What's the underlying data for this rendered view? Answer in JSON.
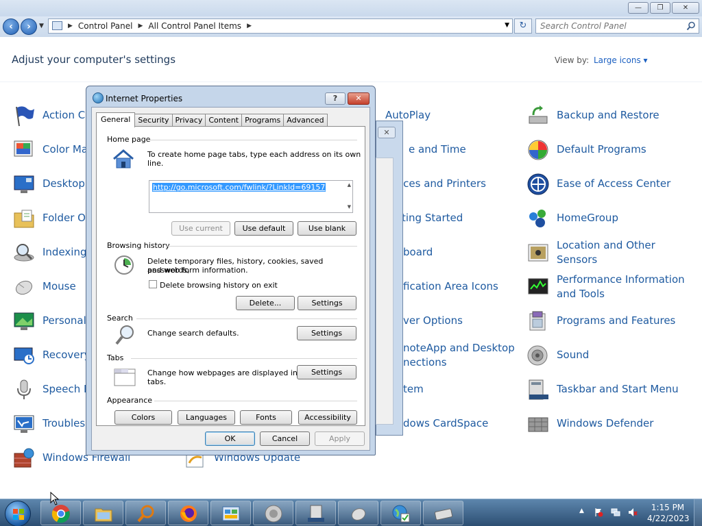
{
  "window": {
    "caption": {
      "minimize": "—",
      "maximize": "❐",
      "close": "✕"
    }
  },
  "nav": {
    "breadcrumb": [
      "Control Panel",
      "All Control Panel Items"
    ],
    "search_placeholder": "Search Control Panel"
  },
  "header": {
    "title": "Adjust your computer's settings",
    "view_by_label": "View by:",
    "view_by_value": "Large icons ▾"
  },
  "control_panel_items": [
    {
      "label": "Action Ce",
      "icon": "flag-icon"
    },
    {
      "label": "Color Ma",
      "icon": "color-management-icon"
    },
    {
      "label": "Desktop (",
      "icon": "desktop-gadgets-icon"
    },
    {
      "label": "Folder Op",
      "icon": "folder-options-icon"
    },
    {
      "label": "Indexing",
      "icon": "indexing-options-icon"
    },
    {
      "label": "Mouse",
      "icon": "mouse-icon"
    },
    {
      "label": "Personali",
      "icon": "personalization-icon"
    },
    {
      "label": "Recovery",
      "icon": "recovery-icon"
    },
    {
      "label": "Speech R",
      "icon": "microphone-icon"
    },
    {
      "label": "Troublesh",
      "icon": "troubleshooting-icon"
    },
    {
      "label": "Windows Firewall",
      "icon": "firewall-icon"
    },
    {
      "label": "Windows Update",
      "icon": "windows-update-icon"
    },
    {
      "label": "AutoPlay",
      "icon": "autoplay-icon"
    },
    {
      "label": "e and Time",
      "icon": "date-time-icon"
    },
    {
      "label": "ices and Printers",
      "icon": "printer-icon"
    },
    {
      "label": "ting Started",
      "icon": "getting-started-icon"
    },
    {
      "label": "board",
      "icon": "keyboard-icon"
    },
    {
      "label": "fication Area Icons",
      "icon": "notification-icon"
    },
    {
      "label": "ver Options",
      "icon": "power-icon"
    },
    {
      "label": "noteApp and Desktop",
      "label2": "nections",
      "icon": "remoteapp-icon"
    },
    {
      "label": "tem",
      "icon": "system-icon"
    },
    {
      "label": "dows CardSpace",
      "icon": "cardspace-icon"
    },
    {
      "label": "Backup and Restore",
      "icon": "backup-icon"
    },
    {
      "label": "Default Programs",
      "icon": "default-programs-icon"
    },
    {
      "label": "Ease of Access Center",
      "icon": "ease-of-access-icon"
    },
    {
      "label": "HomeGroup",
      "icon": "homegroup-icon"
    },
    {
      "label": "Location and Other Sensors",
      "icon": "location-sensors-icon"
    },
    {
      "label": "Performance Information and Tools",
      "icon": "performance-icon"
    },
    {
      "label": "Programs and Features",
      "icon": "programs-features-icon"
    },
    {
      "label": "Sound",
      "icon": "sound-icon"
    },
    {
      "label": "Taskbar and Start Menu",
      "icon": "taskbar-icon"
    },
    {
      "label": "Windows Defender",
      "icon": "defender-icon"
    }
  ],
  "dialog": {
    "title": "Internet Properties",
    "help_button": "?",
    "close_button": "✕",
    "back_close": "✕",
    "tabs": [
      "General",
      "Security",
      "Privacy",
      "Content",
      "Programs",
      "Advanced"
    ],
    "active_tab": "General",
    "home_page": {
      "heading": "Home page",
      "instructions": "To create home page tabs, type each address on its own line.",
      "url": "http://go.microsoft.com/fwlink/?LinkId=69157",
      "use_current": "Use current",
      "use_default": "Use default",
      "use_blank": "Use blank"
    },
    "browsing_history": {
      "heading": "Browsing history",
      "description_line1": "Delete temporary files, history, cookies, saved passwords,",
      "description_line2": "and web form information.",
      "delete_on_exit": "Delete browsing history on exit",
      "delete_button": "Delete...",
      "settings_button": "Settings"
    },
    "search": {
      "heading": "Search",
      "description": "Change search defaults.",
      "settings_button": "Settings"
    },
    "tabs_section": {
      "heading": "Tabs",
      "description_line1": "Change how webpages are displayed in",
      "description_line2": "tabs.",
      "settings_button": "Settings"
    },
    "appearance": {
      "heading": "Appearance",
      "colors": "Colors",
      "languages": "Languages",
      "fonts": "Fonts",
      "accessibility": "Accessibility"
    },
    "footer": {
      "ok": "OK",
      "cancel": "Cancel",
      "apply": "Apply"
    }
  },
  "taskbar": {
    "pinned": [
      "chrome-icon",
      "file-explorer-icon",
      "search-magnifier-icon",
      "firefox-icon",
      "control-panel-icon",
      "speaker-icon",
      "server-icon",
      "mouse-app-icon",
      "internet-options-icon",
      "keyboard-app-icon"
    ],
    "tray_expand": "▲",
    "clock_time": "1:15 PM",
    "clock_date": "4/22/2023"
  }
}
